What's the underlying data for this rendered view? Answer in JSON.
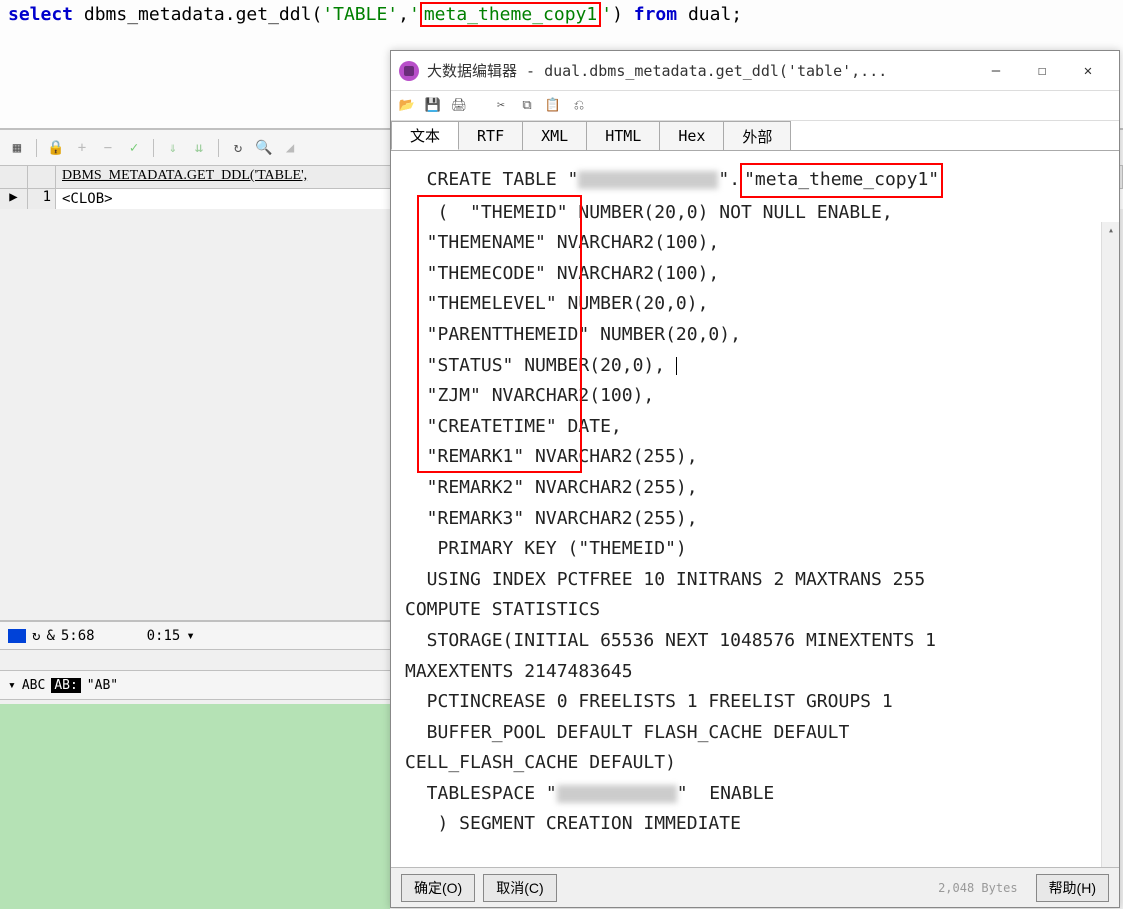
{
  "sql_editor": {
    "kw_select": "select",
    "func": " dbms_metadata.get_ddl(",
    "arg1": "'TABLE'",
    "comma": ",",
    "arg2_q1": "'",
    "arg2_val": "meta_theme_copy1",
    "arg2_q2": "'",
    "paren": ") ",
    "kw_from": "from",
    "rest": " dual;"
  },
  "grid": {
    "column_header": "DBMS_METADATA.GET_DDL('TABLE',",
    "row_marker": "▶",
    "row_num": "1",
    "cell_value": "<CLOB>"
  },
  "status1": {
    "reload_icon": "↻",
    "amp": "&",
    "pos": "5:68",
    "time": "0:15",
    "dropdown": "▾"
  },
  "status2": {
    "dropdown": "▾",
    "abc": "ABC",
    "ab_inv": "AB:",
    "quoted": "\"AB\""
  },
  "dialog": {
    "title": "大数据编辑器 - dual.dbms_metadata.get_ddl('table',...",
    "win_min": "—",
    "win_max": "☐",
    "win_close": "✕",
    "toolbar": {
      "open": "📂",
      "save": "💾",
      "print": "🖨",
      "cut": "✂",
      "copy": "⧉",
      "paste": "📋",
      "undo": "⎌"
    },
    "tabs": {
      "text": "文本",
      "rtf": "RTF",
      "xml": "XML",
      "html": "HTML",
      "hex": "Hex",
      "external": "外部"
    },
    "ddl": {
      "line1_pre": "  CREATE TABLE \"",
      "line1_post": "\".",
      "table_name": "\"meta_theme_copy1\"",
      "line2": "   (  \"THEMEID\" NUMBER(20,0) NOT NULL ENABLE,",
      "line3": "  \"THEMENAME\" NVARCHAR2(100),",
      "line4": "  \"THEMECODE\" NVARCHAR2(100),",
      "line5": "  \"THEMELEVEL\" NUMBER(20,0),",
      "line6": "  \"PARENTTHEMEID\" NUMBER(20,0),",
      "line7_a": "  \"STATUS\" NUMBER(20,0), ",
      "line8": "  \"ZJM\" NVARCHAR2(100),",
      "line9": "  \"CREATETIME\" DATE,",
      "line10": "  \"REMARK1\" NVARCHAR2(255),",
      "line11": "  \"REMARK2\" NVARCHAR2(255),",
      "line12": "  \"REMARK3\" NVARCHAR2(255),",
      "line13": "   PRIMARY KEY (\"THEMEID\")",
      "line14": "  USING INDEX PCTFREE 10 INITRANS 2 MAXTRANS 255 ",
      "line14b": "COMPUTE STATISTICS",
      "line15": "  STORAGE(INITIAL 65536 NEXT 1048576 MINEXTENTS 1 ",
      "line15b": "MAXEXTENTS 2147483645",
      "line16": "  PCTINCREASE 0 FREELISTS 1 FREELIST GROUPS 1",
      "line17": "  BUFFER_POOL DEFAULT FLASH_CACHE DEFAULT ",
      "line17b": "CELL_FLASH_CACHE DEFAULT)",
      "line18_a": "  TABLESPACE \"",
      "line18_b": "\"  ENABLE",
      "line19": "   ) SEGMENT CREATION IMMEDIATE"
    },
    "bottom": {
      "ok": "确定(O)",
      "cancel": "取消(C)",
      "bytes": "2,048 Bytes",
      "help": "帮助(H)"
    }
  }
}
